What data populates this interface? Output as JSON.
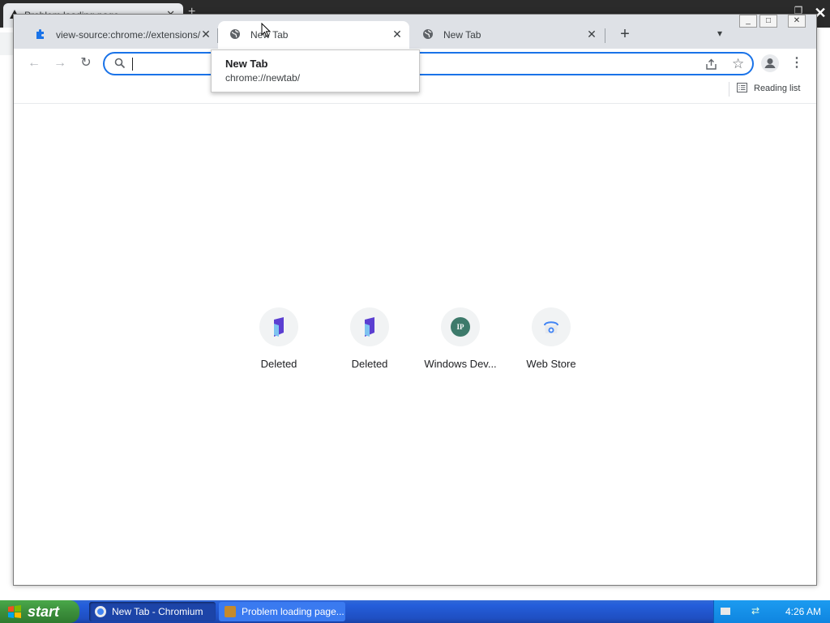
{
  "background_window": {
    "tab_title": "Problem loading page"
  },
  "window": {
    "tabs": [
      {
        "title": "view-source:chrome://extensions/",
        "active": false
      },
      {
        "title": "New Tab",
        "active": true
      },
      {
        "title": "New Tab",
        "active": false
      }
    ]
  },
  "toolbar": {
    "omnibox_value": "",
    "omnibox_placeholder": ""
  },
  "bookmarks_bar": {
    "reading_list_label": "Reading list"
  },
  "hover_card": {
    "title": "New Tab",
    "url": "chrome://newtab/"
  },
  "shortcuts": [
    {
      "title": "Deleted",
      "icon": "purple-bookmark-icon"
    },
    {
      "title": "Deleted",
      "icon": "purple-bookmark-icon"
    },
    {
      "title": "Windows Dev...",
      "icon": "ip-badge-icon",
      "badge": "IP"
    },
    {
      "title": "Web Store",
      "icon": "web-store-icon"
    }
  ],
  "taskbar": {
    "start_label": "start",
    "items": [
      {
        "label": "New Tab - Chromium",
        "active": true
      },
      {
        "label": "Problem loading page...",
        "active": false
      }
    ],
    "clock": "4:26 AM"
  },
  "colors": {
    "accent": "#1a73e8",
    "taskbar": "#245edb",
    "start": "#3c8f3c"
  }
}
